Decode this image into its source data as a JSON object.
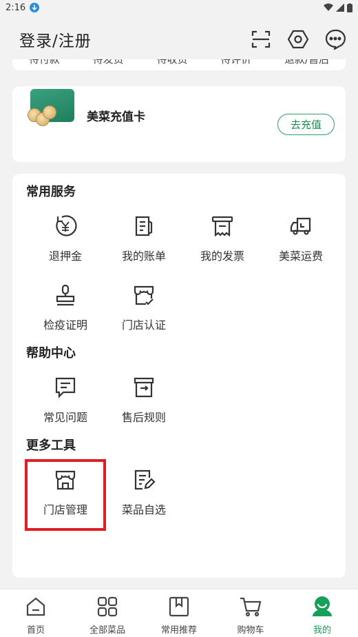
{
  "status": {
    "time": "2:16"
  },
  "header": {
    "title": "登录/注册"
  },
  "orders": {
    "items": [
      "待付款",
      "待发货",
      "待收货",
      "待评价",
      "退款/售后"
    ]
  },
  "recharge": {
    "title": "美菜充值卡",
    "button": "去充值"
  },
  "services": {
    "common": {
      "title": "常用服务",
      "items": [
        "退押金",
        "我的账单",
        "我的发票",
        "美菜运费",
        "检疫证明",
        "门店认证"
      ]
    },
    "help": {
      "title": "帮助中心",
      "items": [
        "常见问题",
        "售后规则"
      ]
    },
    "tools": {
      "title": "更多工具",
      "items": [
        "门店管理",
        "菜品自选"
      ]
    }
  },
  "nav": {
    "items": [
      "首页",
      "全部菜品",
      "常用推荐",
      "购物车",
      "我的"
    ],
    "active": "我的"
  },
  "colors": {
    "accent": "#16a05a",
    "highlight": "#e21d22"
  }
}
